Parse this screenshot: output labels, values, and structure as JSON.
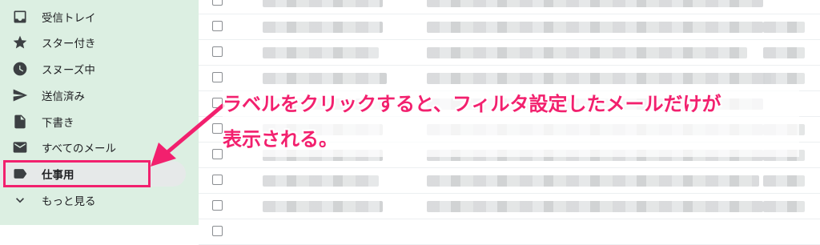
{
  "sidebar": {
    "items": [
      {
        "label": "受信トレイ",
        "icon": "inbox-icon"
      },
      {
        "label": "スター付き",
        "icon": "star-icon"
      },
      {
        "label": "スヌーズ中",
        "icon": "clock-icon"
      },
      {
        "label": "送信済み",
        "icon": "send-icon"
      },
      {
        "label": "下書き",
        "icon": "draft-icon"
      },
      {
        "label": "すべてのメール",
        "icon": "mail-icon"
      },
      {
        "label": "仕事用",
        "icon": "label-icon",
        "selected": true
      },
      {
        "label": "もっと見る",
        "icon": "chevron-down-icon"
      }
    ]
  },
  "annotation": {
    "line1": "ラベルをクリックすると、フィルタ設定したメールだけが",
    "line2": "表示される。",
    "color": "#f2206e"
  },
  "colors": {
    "sidebar_bg": "#dcefe2",
    "accent": "#f2206e"
  }
}
